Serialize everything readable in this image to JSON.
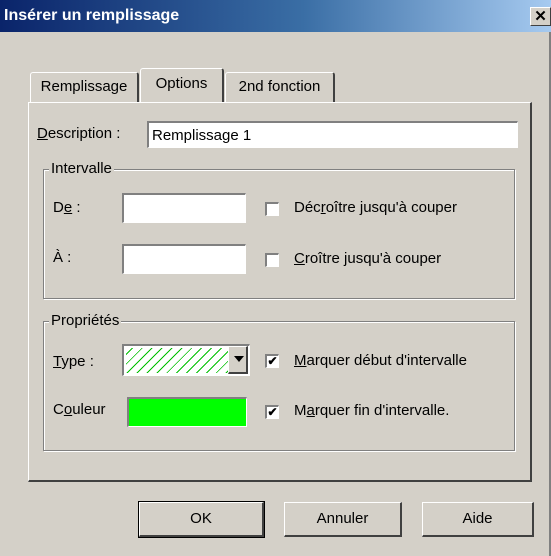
{
  "window": {
    "title": "Insérer un remplissage",
    "close_glyph": "✕"
  },
  "tabs": [
    {
      "label": "Remplissage",
      "active": false
    },
    {
      "label": "Options",
      "active": true
    },
    {
      "label": "2nd fonction",
      "active": false
    }
  ],
  "description": {
    "label_pre": "",
    "label_ul": "D",
    "label_post": "escription :",
    "value": "Remplissage 1"
  },
  "intervalle": {
    "legend": "Intervalle",
    "de_label_pre": "D",
    "de_label_ul": "e",
    "de_label_post": " :",
    "de_value": "",
    "a_label": "À :",
    "a_value": "",
    "decroitre": {
      "pre": "Déc",
      "ul": "r",
      "post": "oître jusqu'à couper",
      "checked": false
    },
    "croitre": {
      "pre": "",
      "ul": "C",
      "post": "roître jusqu'à couper",
      "checked": false
    }
  },
  "proprietes": {
    "legend": "Propriétés",
    "type_label_pre": "",
    "type_label_ul": "T",
    "type_label_post": "ype :",
    "couleur_label_pre": "C",
    "couleur_label_ul": "o",
    "couleur_label_post": "uleur",
    "color_value": "#00ff00",
    "hatch_color": "#00c000",
    "marquer_debut": {
      "pre": "",
      "ul": "M",
      "post": "arquer début d'intervalle",
      "checked": true
    },
    "marquer_fin": {
      "pre": "M",
      "ul": "a",
      "post": "rquer fin d'intervalle.",
      "checked": true
    }
  },
  "buttons": {
    "ok": "OK",
    "annuler": "Annuler",
    "aide": "Aide"
  }
}
